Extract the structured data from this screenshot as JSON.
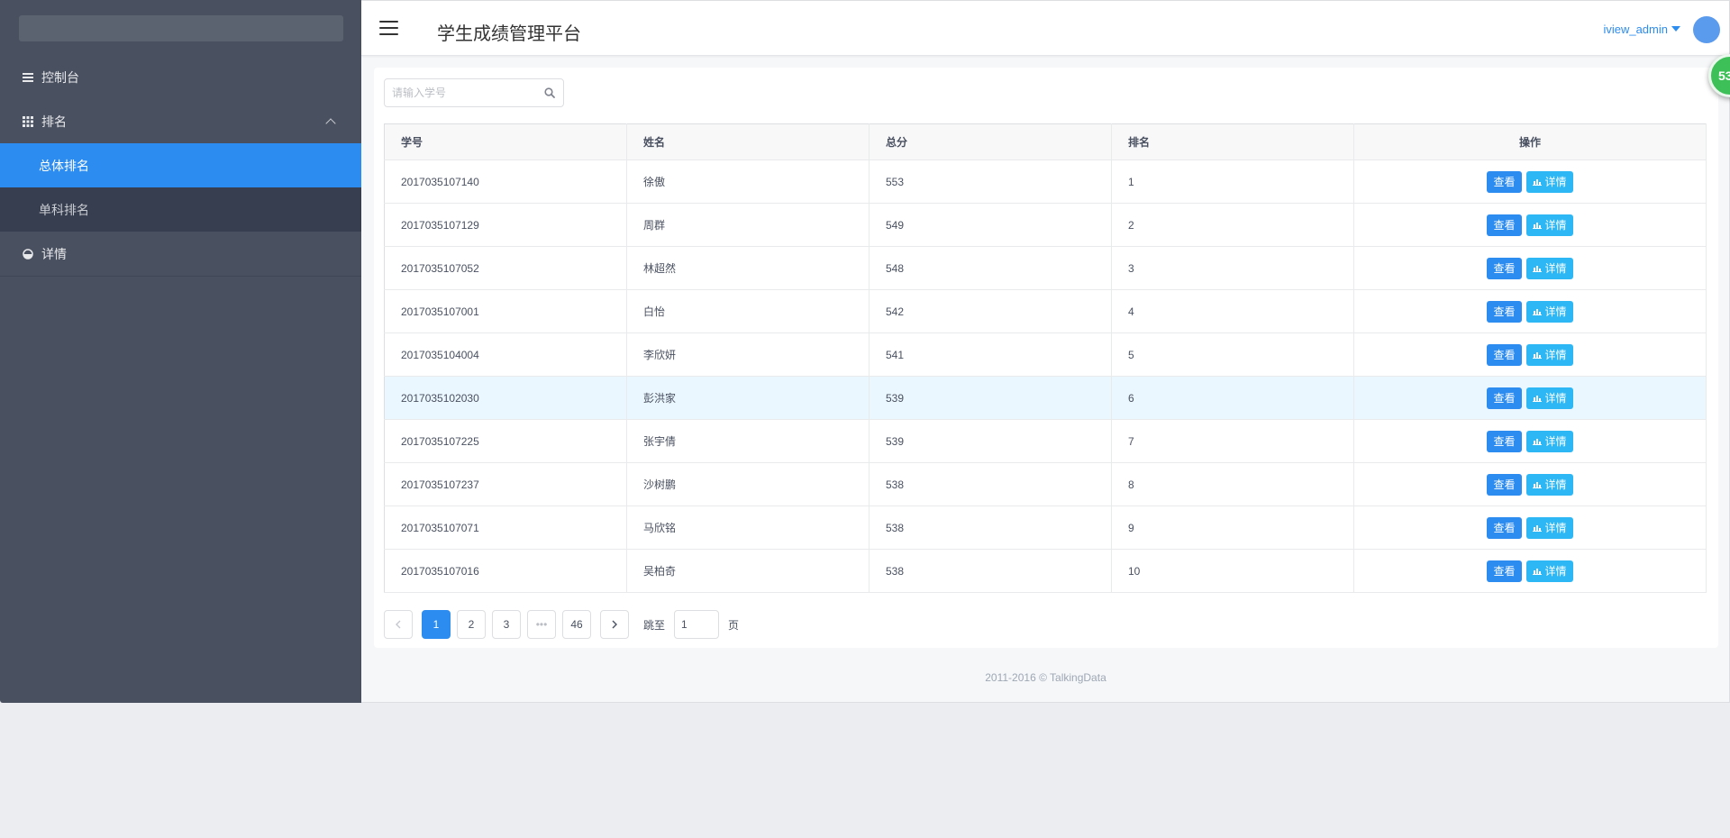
{
  "header": {
    "title": "学生成绩管理平台",
    "user": "iview_admin"
  },
  "float_badge": {
    "text": "53"
  },
  "sidebar": {
    "items": [
      {
        "label": "控制台",
        "icon": "list-icon"
      },
      {
        "label": "排名",
        "icon": "grid-icon",
        "expanded": true,
        "children": [
          {
            "label": "总体排名",
            "active": true
          },
          {
            "label": "单科排名",
            "active": false
          }
        ]
      },
      {
        "label": "详情",
        "icon": "pie-chart-icon"
      }
    ]
  },
  "search": {
    "placeholder": "请输入学号",
    "value": ""
  },
  "table": {
    "columns": [
      "学号",
      "姓名",
      "总分",
      "排名",
      "操作"
    ],
    "rows": [
      [
        "2017035107140",
        "徐傲",
        "553",
        "1"
      ],
      [
        "2017035107129",
        "周群",
        "549",
        "2"
      ],
      [
        "2017035107052",
        "林超然",
        "548",
        "3"
      ],
      [
        "2017035107001",
        "白怡",
        "542",
        "4"
      ],
      [
        "2017035104004",
        "李欣妍",
        "541",
        "5"
      ],
      [
        "2017035102030",
        "彭洪家",
        "539",
        "6"
      ],
      [
        "2017035107225",
        "张宇倩",
        "539",
        "7"
      ],
      [
        "2017035107237",
        "沙树鹏",
        "538",
        "8"
      ],
      [
        "2017035107071",
        "马欣铭",
        "538",
        "9"
      ],
      [
        "2017035107016",
        "吴柏奇",
        "538",
        "10"
      ]
    ],
    "view_label": "查看",
    "detail_label": "详情"
  },
  "pagination": {
    "pages": [
      "1",
      "2",
      "3",
      "•••",
      "46"
    ],
    "current": "1",
    "jump_label": "跳至",
    "jump_value": "1",
    "page_suffix": "页"
  },
  "footer": {
    "text": "2011-2016 © TalkingData"
  },
  "colors": {
    "primary": "#2d8cf0",
    "info": "#2db7f5",
    "sidebar_bg": "#495060",
    "submenu_bg": "#363e4f",
    "badge": "#3cc057"
  }
}
